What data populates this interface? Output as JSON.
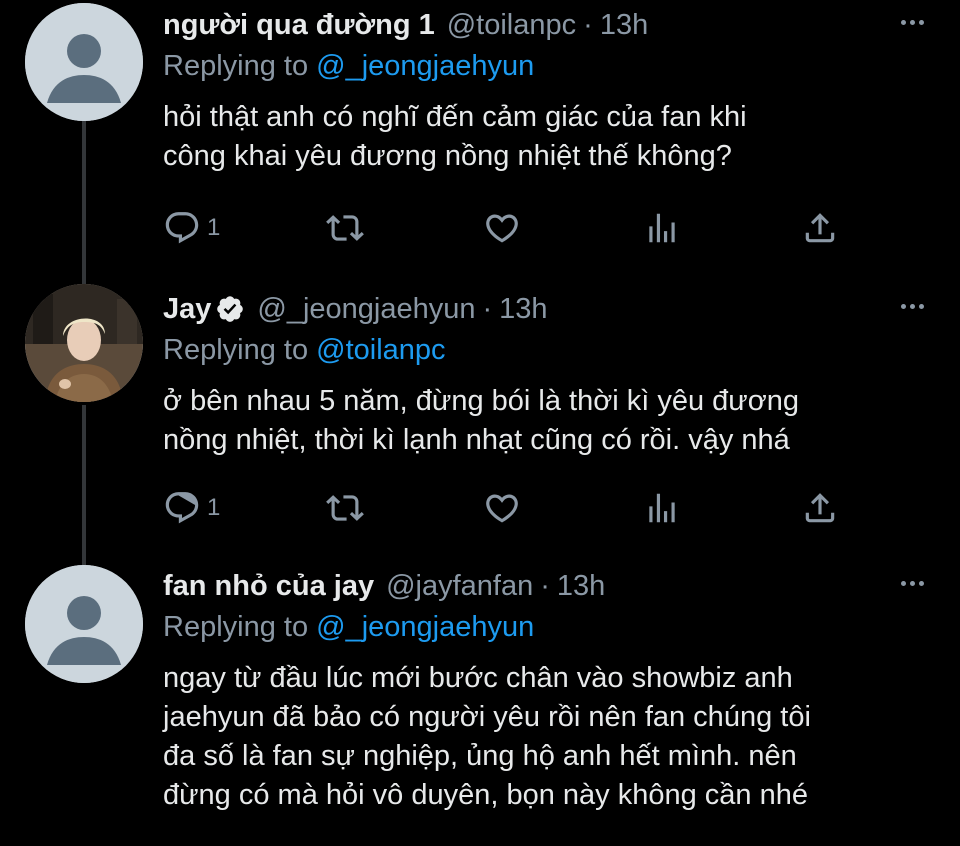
{
  "tweets": [
    {
      "name": "người qua đường 1",
      "verified": false,
      "handle": "@toilanpc",
      "separator": "·",
      "time": "13h",
      "replying_prefix": "Replying to",
      "replying_to": "@_jeongjaehyun",
      "text": "hỏi thật anh có nghĩ đến cảm giác của fan khi\ncông khai yêu đương nồng nhiệt thế không?",
      "reply_count": "1",
      "avatar": "default-avatar"
    },
    {
      "name": "Jay",
      "verified": true,
      "handle": "@_jeongjaehyun",
      "separator": "·",
      "time": "13h",
      "replying_prefix": "Replying to",
      "replying_to": "@toilanpc",
      "text": "ở bên nhau 5 năm, đừng bói là thời kì yêu đương\nnồng nhiệt, thời kì lạnh nhạt cũng có rồi. vậy nhá",
      "reply_count": "1",
      "avatar": "photo-avatar"
    },
    {
      "name": "fan nhỏ của jay",
      "verified": false,
      "handle": "@jayfanfan",
      "separator": "·",
      "time": "13h",
      "replying_prefix": "Replying to",
      "replying_to": "@_jeongjaehyun",
      "text": "ngay từ đầu lúc mới bước chân vào showbiz anh\njaehyun đã bảo có người yêu rồi nên fan chúng tôi\nđa số là fan sự nghiệp, ủng hộ anh hết mình. nên\nđừng có mà hỏi vô duyên, bọn này không cần nhé",
      "avatar": "default-avatar"
    }
  ],
  "colors": {
    "background": "#000000",
    "text": "#e7e9ea",
    "secondary": "#8b98a5",
    "accent": "#1d9bf0"
  },
  "icons": [
    "reply-icon",
    "retweet-icon",
    "like-icon",
    "analytics-icon",
    "share-icon",
    "more-icon",
    "verified-badge-icon"
  ]
}
